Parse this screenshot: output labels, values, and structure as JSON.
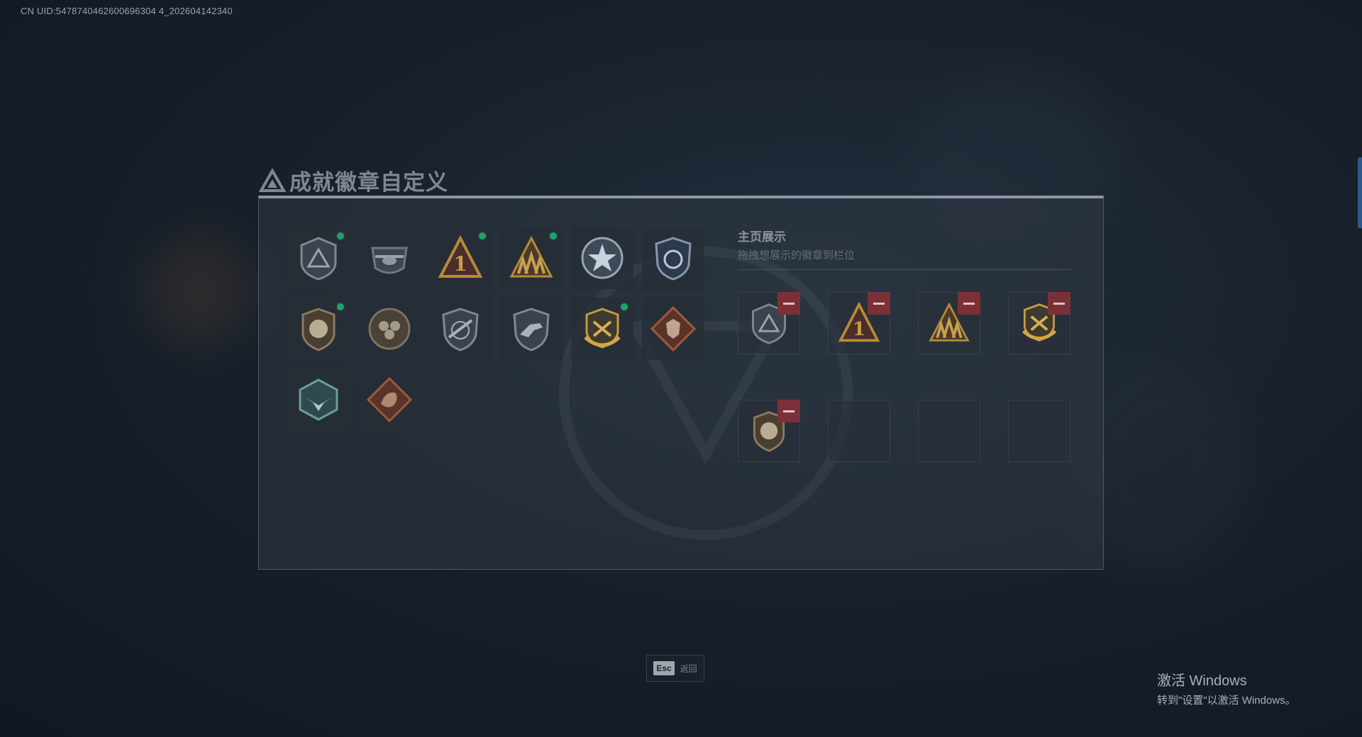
{
  "uid_text": "CN UID:5478740462600696304 4_202604142340",
  "title": "成就徽章自定义",
  "badges": [
    {
      "icon": "triangle-shield-badge-icon",
      "new": true
    },
    {
      "icon": "helicopter-badge-icon",
      "new": false
    },
    {
      "icon": "number-one-triangle-badge-icon",
      "new": true
    },
    {
      "icon": "squad-triangle-badge-icon",
      "new": true
    },
    {
      "icon": "star-wreath-badge-icon",
      "new": false
    },
    {
      "icon": "police-shield-badge-icon",
      "new": false
    },
    {
      "icon": "lion-shield-badge-icon",
      "new": true
    },
    {
      "icon": "flower-round-badge-icon",
      "new": false
    },
    {
      "icon": "rifle-shield-badge-icon",
      "new": false
    },
    {
      "icon": "dino-shield-badge-icon",
      "new": false
    },
    {
      "icon": "gold-laurel-badge-icon",
      "new": true
    },
    {
      "icon": "wolf-diamond-badge-icon",
      "new": false
    },
    {
      "icon": "eagle-hexagon-badge-icon",
      "new": false
    },
    {
      "icon": "dragon-diamond-badge-icon",
      "new": false
    }
  ],
  "showcase": {
    "title": "主页展示",
    "subtitle": "拖拽想展示的徽章到栏位",
    "slots": [
      {
        "icon": "triangle-shield-badge-icon",
        "filled": true
      },
      {
        "icon": "number-one-triangle-badge-icon",
        "filled": true
      },
      {
        "icon": "squad-triangle-badge-icon",
        "filled": true
      },
      {
        "icon": "gold-laurel-badge-icon",
        "filled": true
      },
      {
        "icon": "lion-shield-badge-icon",
        "filled": true
      },
      {
        "icon": "",
        "filled": false
      },
      {
        "icon": "",
        "filled": false
      },
      {
        "icon": "",
        "filled": false
      }
    ]
  },
  "esc": {
    "key": "Esc",
    "label": "返回"
  },
  "windows_activation": {
    "line1": "激活 Windows",
    "line2": "转到\"设置\"以激活 Windows。"
  },
  "colors": {
    "new_dot": "#1fa36a",
    "remove_button": "#7a3036",
    "gold": "#b58a3a"
  }
}
